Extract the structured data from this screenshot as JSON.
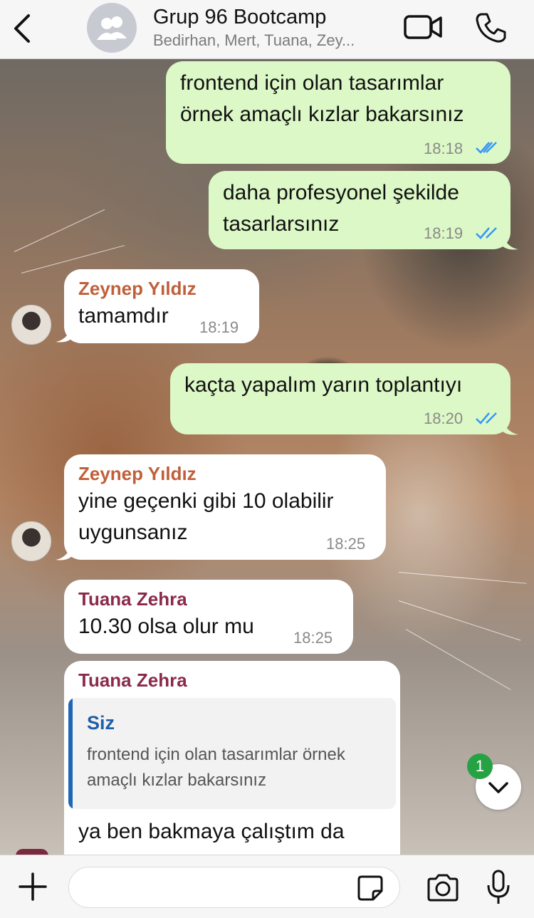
{
  "header": {
    "title": "Grup 96 Bootcamp",
    "subtitle": "Bedirhan, Mert, Tuana, Zey..."
  },
  "messages": [
    {
      "type": "outgoing",
      "lines": [
        "frontend için olan tasarımlar",
        "örnek amaçlı kızlar bakarsınız"
      ],
      "time": "18:18",
      "status": "read"
    },
    {
      "type": "outgoing",
      "lines": [
        "daha profesyonel şekilde",
        "tasarlarsınız"
      ],
      "time": "18:19",
      "status": "read"
    },
    {
      "type": "incoming",
      "sender": "Zeynep Yıldız",
      "sender_color": "#c0603a",
      "lines": [
        "tamamdır"
      ],
      "time": "18:19"
    },
    {
      "type": "outgoing",
      "lines": [
        "kaçta yapalım yarın toplantıyı"
      ],
      "time": "18:20",
      "status": "read"
    },
    {
      "type": "incoming",
      "sender": "Zeynep Yıldız",
      "sender_color": "#c0603a",
      "lines": [
        "yine geçenki gibi 10 olabilir",
        "uygunsanız"
      ],
      "time": "18:25"
    },
    {
      "type": "incoming",
      "sender": "Tuana Zehra",
      "sender_color": "#8b2a4a",
      "lines": [
        "10.30 olsa olur mu"
      ],
      "time": "18:25"
    },
    {
      "type": "incoming",
      "sender": "Tuana Zehra",
      "sender_color": "#8b2a4a",
      "quote": {
        "author": "Siz",
        "text": "frontend için olan tasarımlar örnek amaçlı kızlar bakarsınız"
      },
      "lines": [
        "ya ben bakmaya çalıştım da"
      ]
    }
  ],
  "scroll_down": {
    "unread_count": "1"
  },
  "input": {
    "value": "",
    "placeholder": ""
  },
  "colors": {
    "outgoing_bubble": "#dcf8c6",
    "incoming_bubble": "#ffffff",
    "read_ticks": "#3497f9",
    "badge": "#26a245"
  }
}
